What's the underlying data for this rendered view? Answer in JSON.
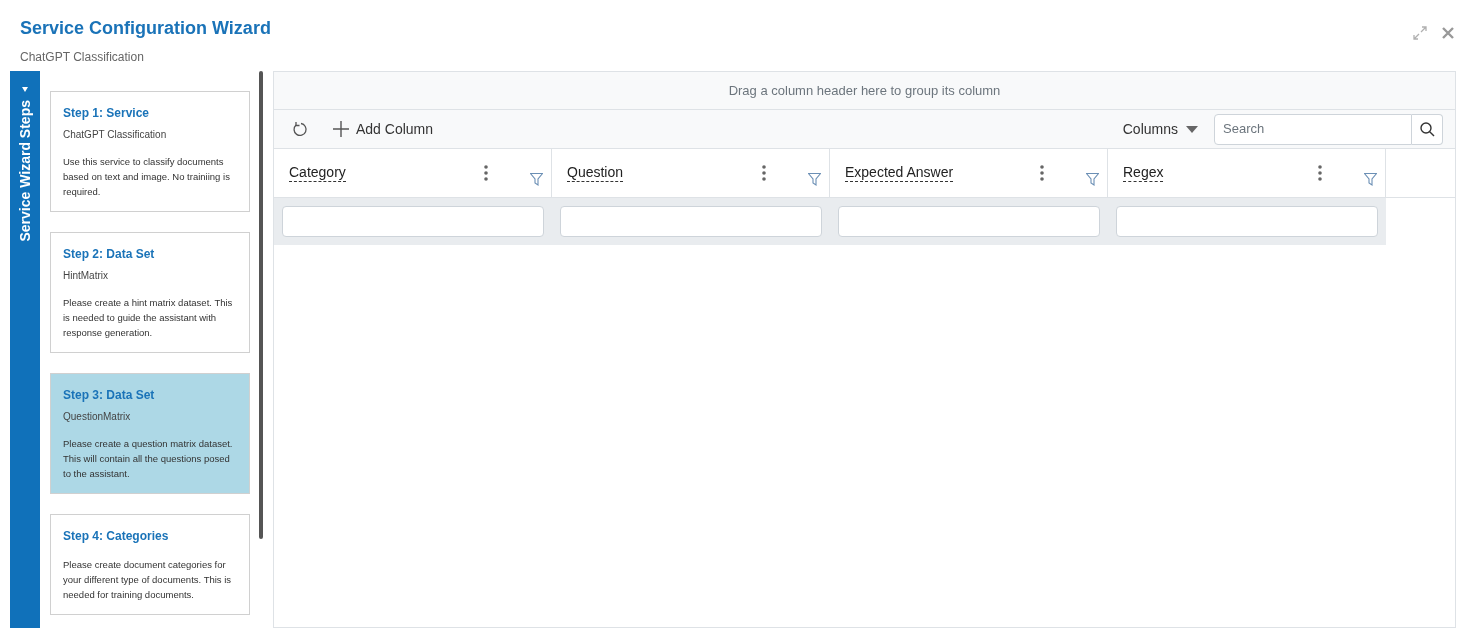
{
  "window": {
    "title": "Service Configuration Wizard",
    "subtitle": "ChatGPT Classification"
  },
  "side_tab": {
    "label": "Service Wizard Steps"
  },
  "steps": [
    {
      "title": "Step 1: Service",
      "subtitle": "ChatGPT Classification",
      "description": "Use this service to classify documents based on text and image. No trainiing is required.",
      "selected": false
    },
    {
      "title": "Step 2: Data Set",
      "subtitle": "HintMatrix",
      "description": "Please create a hint matrix dataset. This is needed to guide the assistant with response generation.",
      "selected": false
    },
    {
      "title": "Step 3: Data Set",
      "subtitle": "QuestionMatrix",
      "description": "Please create a question matrix dataset. This will contain all the questions posed to the assistant.",
      "selected": true
    },
    {
      "title": "Step 4: Categories",
      "description": "Please create document categories for your different type of documents. This is needed for training documents.",
      "selected": false
    }
  ],
  "grid": {
    "group_panel": "Drag a column header here to group its column",
    "add_button": "Add Column",
    "columns_button": "Columns",
    "search": {
      "placeholder": "Search"
    },
    "columns": [
      "Category",
      "Question",
      "Expected Answer",
      "Regex"
    ]
  }
}
